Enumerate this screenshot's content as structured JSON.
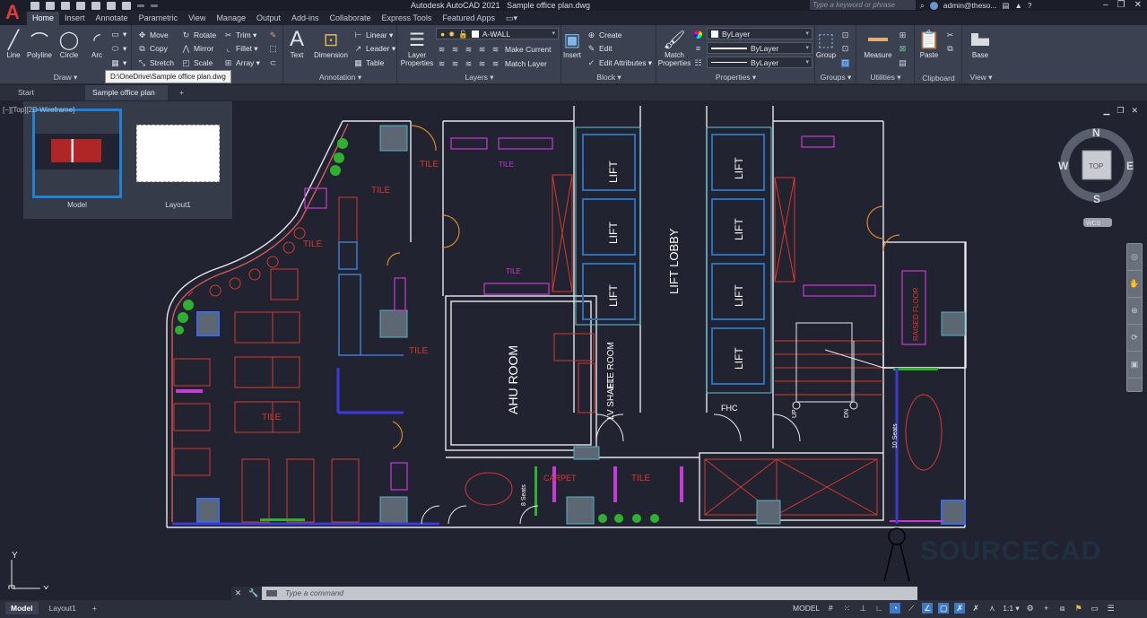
{
  "app": {
    "logo": "A",
    "title": "Autodesk AutoCAD 2021",
    "file": "Sample office plan.dwg",
    "search_placeholder": "Type a keyword or phrase",
    "user": "admin@theso...",
    "window_controls": [
      "–",
      "❐",
      "✕"
    ]
  },
  "ribbon_tabs": [
    {
      "label": "Home",
      "active": true
    },
    {
      "label": "Insert"
    },
    {
      "label": "Annotate"
    },
    {
      "label": "Parametric"
    },
    {
      "label": "View"
    },
    {
      "label": "Manage"
    },
    {
      "label": "Output"
    },
    {
      "label": "Add-ins"
    },
    {
      "label": "Collaborate"
    },
    {
      "label": "Express Tools"
    },
    {
      "label": "Featured Apps"
    }
  ],
  "panels": {
    "draw": {
      "label": "Draw ▾",
      "buttons": [
        "Line",
        "Polyline",
        "Circle",
        "Arc"
      ]
    },
    "modify": {
      "rows": [
        [
          "Move",
          "Rotate",
          "Trim ▾"
        ],
        [
          "Copy",
          "Mirror",
          "Fillet ▾"
        ],
        [
          "Stretch",
          "Scale",
          "Array ▾"
        ]
      ]
    },
    "annotation": {
      "label": "Annotation ▾",
      "big": [
        "Text",
        "Dimension"
      ],
      "small": [
        "Linear ▾",
        "Leader ▾",
        "Table"
      ]
    },
    "layers": {
      "label": "Layers ▾",
      "big": "Layer Properties",
      "current_layer": "A-WALL",
      "small": [
        "Make Current",
        "Match Layer"
      ]
    },
    "block": {
      "label": "Block ▾",
      "big": "Insert",
      "small": [
        "Create",
        "Edit",
        "Edit Attributes ▾"
      ]
    },
    "properties": {
      "label": "Properties ▾",
      "big": "Match Properties",
      "color": "ByLayer",
      "lineweight": "ByLayer",
      "linetype": "ByLayer"
    },
    "groups": {
      "label": "Groups ▾",
      "big": "Group"
    },
    "utilities": {
      "label": "Utilities ▾",
      "big": "Measure"
    },
    "clipboard": {
      "label": "Clipboard",
      "big": "Paste"
    },
    "view": {
      "label": "View ▾",
      "big": "Base"
    }
  },
  "tooltip": "D:\\OneDrive\\Sample office plan.dwg",
  "doc_tabs": [
    {
      "label": "Start"
    },
    {
      "label": "Sample office plan",
      "active": true,
      "close": "✕"
    },
    {
      "label": "+"
    }
  ],
  "viewport": {
    "label": "[−][Top][2D Wireframe]",
    "thumbnails": [
      "Model",
      "Layout1"
    ],
    "viewcube": {
      "n": "N",
      "s": "S",
      "e": "E",
      "w": "W",
      "face": "TOP",
      "ucs": "WCS"
    },
    "ucs_axes": {
      "x": "X",
      "y": "Y"
    },
    "watermark": "SOURCECAD"
  },
  "drawing_labels": {
    "tile": "TILE",
    "lift": "LIFT",
    "lift_lobby": "LIFT LOBBY",
    "ahu_room": "AHU ROOM",
    "ele_room": "ELE ROOM",
    "lv_shaft": "LV SHAFT",
    "fhc": "FHC",
    "up": "UP",
    "dn": "DN",
    "seats_8": "8 Seats",
    "seats_10": "10 Seats",
    "carpet": "CARPET",
    "raised_floor": "RAISED FLOOR"
  },
  "command": {
    "placeholder": "Type a command"
  },
  "layout_tabs": [
    {
      "label": "Model",
      "active": true
    },
    {
      "label": "Layout1"
    },
    {
      "label": "+"
    }
  ],
  "status": {
    "model": "MODEL",
    "scale": "1:1 ▾"
  }
}
